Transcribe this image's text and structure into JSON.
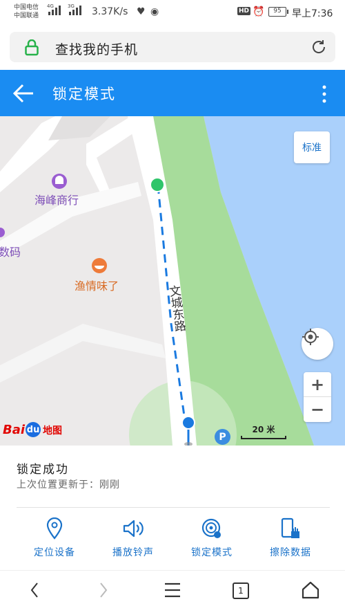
{
  "status_bar": {
    "carrier1": "中国电信",
    "carrier2": "中国联通",
    "net1": "4G",
    "net2": "3G",
    "speed": "3.37K/s",
    "hd": "HD",
    "battery": "95",
    "time": "早上7:36"
  },
  "browser": {
    "url_text": "查找我的手机"
  },
  "header": {
    "title": "锁定模式"
  },
  "map": {
    "standard_label": "标准",
    "poi1": "海峰商行",
    "poi2": "数码",
    "poi3": "渔情味了",
    "road": "文城东路",
    "scale": "20 米",
    "baidu_bai": "Bai",
    "baidu_du": "du",
    "baidu_map": "地图",
    "parking": "P",
    "zoom_in": "+",
    "zoom_out": "−"
  },
  "info": {
    "status": "锁定成功",
    "last_update": "上次位置更新于：刚刚"
  },
  "actions": [
    {
      "label": "定位设备"
    },
    {
      "label": "播放铃声"
    },
    {
      "label": "锁定模式"
    },
    {
      "label": "擦除数据"
    }
  ],
  "nav": {
    "tabs_count": "1"
  },
  "colors": {
    "accent": "#1a8cf2",
    "action_text": "#1a72c9",
    "water": "#aad0fb",
    "park": "#a7dc9b"
  }
}
